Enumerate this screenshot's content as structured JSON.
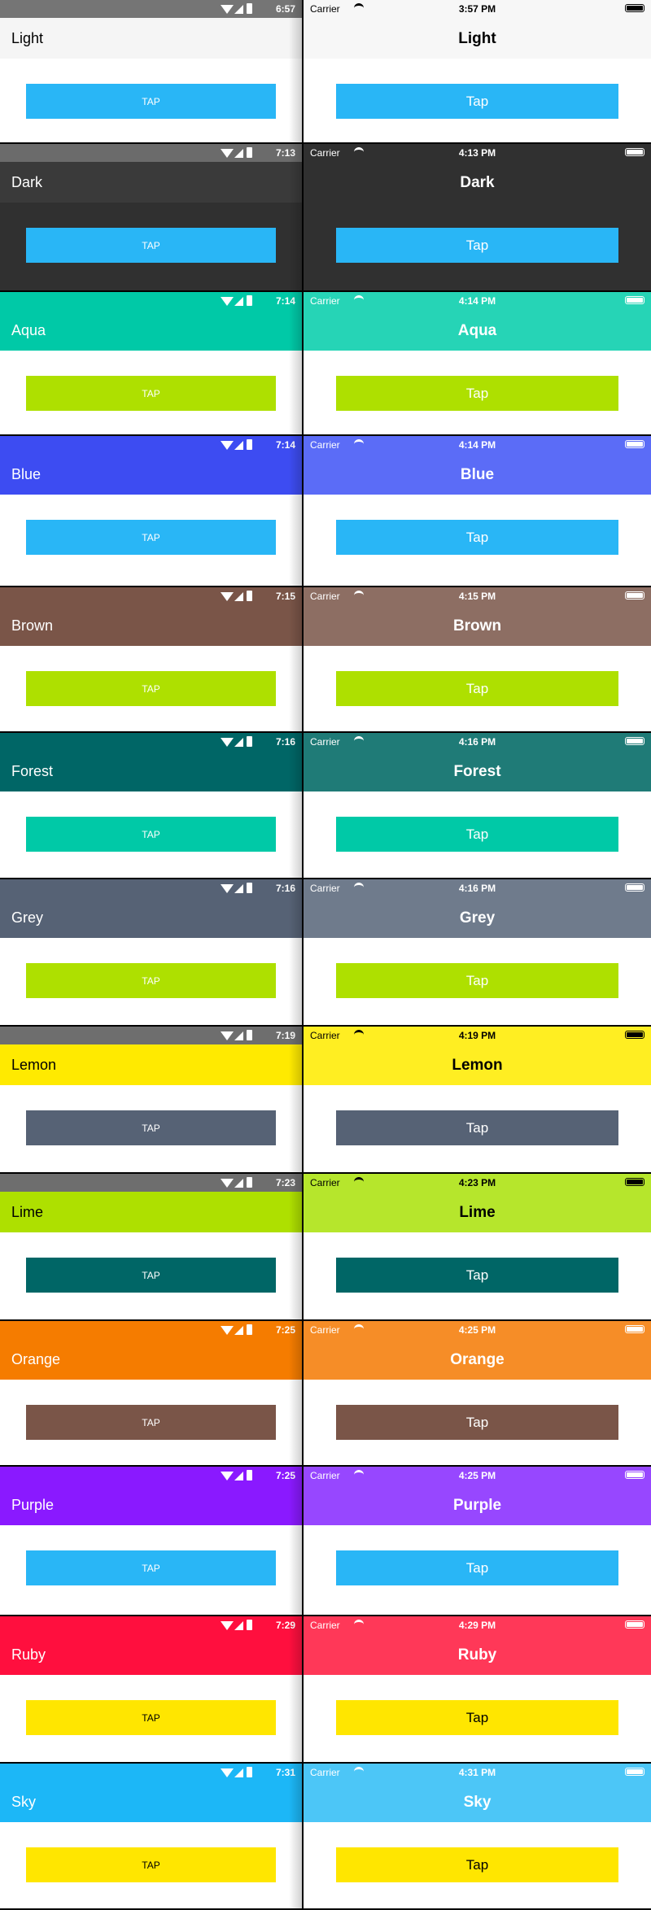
{
  "themes": [
    {
      "name": "Light",
      "button": {
        "android": "TAP",
        "ios": "Tap"
      },
      "android": {
        "time": "6:57",
        "status_bg": "#757575",
        "bar_bg": "#f5f5f5",
        "title_color": "#000000"
      },
      "ios": {
        "carrier": "Carrier",
        "time": "3:57 PM",
        "status_bg": "#f7f7f7",
        "status_fg": "#000000",
        "bar_bg": "#f7f7f7",
        "title_color": "#000000"
      },
      "button_bg": "#29b6f6",
      "button_fg": "#ffffff"
    },
    {
      "name": "Dark",
      "button": {
        "android": "TAP",
        "ios": "Tap"
      },
      "android": {
        "time": "7:13",
        "status_bg": "#6b6b6b",
        "bar_bg": "#3a3a3a",
        "title_color": "#ffffff",
        "content_bg": "#303030"
      },
      "ios": {
        "carrier": "Carrier",
        "time": "4:13 PM",
        "status_bg": "#303030",
        "status_fg": "#ffffff",
        "bar_bg": "#303030",
        "title_color": "#ffffff",
        "content_bg": "#303030"
      },
      "button_bg": "#29b6f6",
      "button_fg": "#ffffff"
    },
    {
      "name": "Aqua",
      "button": {
        "android": "TAP",
        "ios": "Tap"
      },
      "android": {
        "time": "7:14",
        "status_bg": "#00c9a7",
        "bar_bg": "#00c9a7",
        "title_color": "#ffffff"
      },
      "ios": {
        "carrier": "Carrier",
        "time": "4:14 PM",
        "status_bg": "#26d4b6",
        "status_fg": "#ffffff",
        "bar_bg": "#26d4b6",
        "title_color": "#ffffff"
      },
      "button_bg": "#aee000",
      "button_fg": "#ffffff"
    },
    {
      "name": "Blue",
      "button": {
        "android": "TAP",
        "ios": "Tap"
      },
      "android": {
        "time": "7:14",
        "status_bg": "#3d4cf2",
        "bar_bg": "#3d4cf2",
        "title_color": "#ffffff"
      },
      "ios": {
        "carrier": "Carrier",
        "time": "4:14 PM",
        "status_bg": "#5b6cf7",
        "status_fg": "#ffffff",
        "bar_bg": "#5b6cf7",
        "title_color": "#ffffff"
      },
      "button_bg": "#29b6f6",
      "button_fg": "#ffffff"
    },
    {
      "name": "Brown",
      "button": {
        "android": "TAP",
        "ios": "Tap"
      },
      "android": {
        "time": "7:15",
        "status_bg": "#7a5548",
        "bar_bg": "#7a5548",
        "title_color": "#ffffff"
      },
      "ios": {
        "carrier": "Carrier",
        "time": "4:15 PM",
        "status_bg": "#8d6e63",
        "status_fg": "#ffffff",
        "bar_bg": "#8d6e63",
        "title_color": "#ffffff"
      },
      "button_bg": "#aee000",
      "button_fg": "#ffffff"
    },
    {
      "name": "Forest",
      "button": {
        "android": "TAP",
        "ios": "Tap"
      },
      "android": {
        "time": "7:16",
        "status_bg": "#006666",
        "bar_bg": "#006666",
        "title_color": "#ffffff"
      },
      "ios": {
        "carrier": "Carrier",
        "time": "4:16 PM",
        "status_bg": "#1f7b77",
        "status_fg": "#ffffff",
        "bar_bg": "#1f7b77",
        "title_color": "#ffffff"
      },
      "button_bg": "#00c9a7",
      "button_fg": "#ffffff"
    },
    {
      "name": "Grey",
      "button": {
        "android": "TAP",
        "ios": "Tap"
      },
      "android": {
        "time": "7:16",
        "status_bg": "#566275",
        "bar_bg": "#566275",
        "title_color": "#ffffff"
      },
      "ios": {
        "carrier": "Carrier",
        "time": "4:16 PM",
        "status_bg": "#6f7b8c",
        "status_fg": "#ffffff",
        "bar_bg": "#6f7b8c",
        "title_color": "#ffffff"
      },
      "button_bg": "#aee000",
      "button_fg": "#ffffff"
    },
    {
      "name": "Lemon",
      "button": {
        "android": "TAP",
        "ios": "Tap"
      },
      "android": {
        "time": "7:19",
        "status_bg": "#6e6e6e",
        "bar_bg": "#ffea00",
        "title_color": "#000000"
      },
      "ios": {
        "carrier": "Carrier",
        "time": "4:19 PM",
        "status_bg": "#ffee22",
        "status_fg": "#000000",
        "bar_bg": "#ffee22",
        "title_color": "#000000"
      },
      "button_bg": "#566275",
      "button_fg": "#ffffff"
    },
    {
      "name": "Lime",
      "button": {
        "android": "TAP",
        "ios": "Tap"
      },
      "android": {
        "time": "7:23",
        "status_bg": "#6e6e6e",
        "bar_bg": "#aee000",
        "title_color": "#000000"
      },
      "ios": {
        "carrier": "Carrier",
        "time": "4:23 PM",
        "status_bg": "#b6e62c",
        "status_fg": "#000000",
        "bar_bg": "#b6e62c",
        "title_color": "#000000"
      },
      "button_bg": "#006666",
      "button_fg": "#ffffff"
    },
    {
      "name": "Orange",
      "button": {
        "android": "TAP",
        "ios": "Tap"
      },
      "android": {
        "time": "7:25",
        "status_bg": "#f57c00",
        "bar_bg": "#f57c00",
        "title_color": "#ffffff"
      },
      "ios": {
        "carrier": "Carrier",
        "time": "4:25 PM",
        "status_bg": "#f68d27",
        "status_fg": "#ffffff",
        "bar_bg": "#f68d27",
        "title_color": "#ffffff"
      },
      "button_bg": "#7a5548",
      "button_fg": "#ffffff"
    },
    {
      "name": "Purple",
      "button": {
        "android": "TAP",
        "ios": "Tap"
      },
      "android": {
        "time": "7:25",
        "status_bg": "#8a19ff",
        "bar_bg": "#8a19ff",
        "title_color": "#ffffff"
      },
      "ios": {
        "carrier": "Carrier",
        "time": "4:25 PM",
        "status_bg": "#9747ff",
        "status_fg": "#ffffff",
        "bar_bg": "#9747ff",
        "title_color": "#ffffff"
      },
      "button_bg": "#29b6f6",
      "button_fg": "#ffffff"
    },
    {
      "name": "Ruby",
      "button": {
        "android": "TAP",
        "ios": "Tap"
      },
      "android": {
        "time": "7:29",
        "status_bg": "#ff0f3e",
        "bar_bg": "#ff0f3e",
        "title_color": "#ffffff"
      },
      "ios": {
        "carrier": "Carrier",
        "time": "4:29 PM",
        "status_bg": "#ff3858",
        "status_fg": "#ffffff",
        "bar_bg": "#ff3858",
        "title_color": "#ffffff"
      },
      "button_bg": "#ffe600",
      "button_fg": "#000000"
    },
    {
      "name": "Sky",
      "button": {
        "android": "TAP",
        "ios": "Tap"
      },
      "android": {
        "time": "7:31",
        "status_bg": "#1cb7f7",
        "bar_bg": "#1cb7f7",
        "title_color": "#ffffff"
      },
      "ios": {
        "carrier": "Carrier",
        "time": "4:31 PM",
        "status_bg": "#4cc6f7",
        "status_fg": "#ffffff",
        "bar_bg": "#4cc6f7",
        "title_color": "#ffffff"
      },
      "button_bg": "#ffe600",
      "button_fg": "#000000"
    }
  ]
}
